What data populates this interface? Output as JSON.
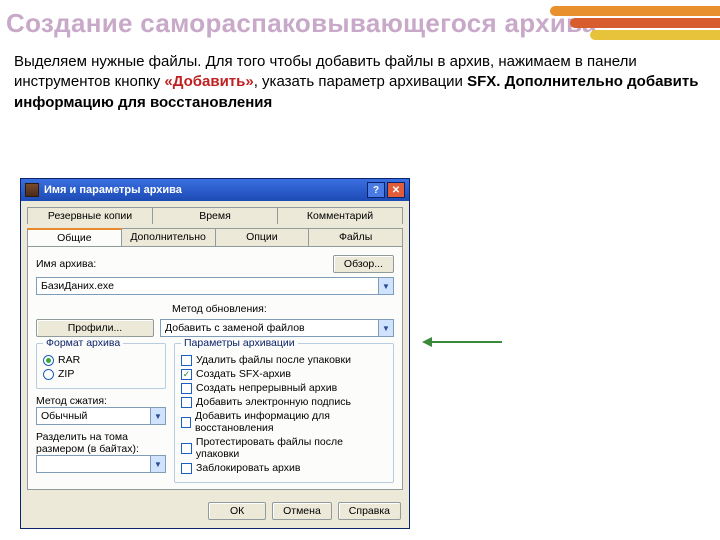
{
  "slide": {
    "title": "Создание самораспаковывающегося архива",
    "instruction_pre": "Выделяем нужные файлы. Для того чтобы добавить файлы в архив, нажимаем в панели инструментов кнопку ",
    "add_quoted": "«Добавить»",
    "instruction_mid": ",  указать параметр архивации ",
    "sfx_bold": "SFX. Дополнительно добавить информацию для восстановления"
  },
  "dialog": {
    "title": "Имя и параметры архива",
    "help_btn": "?",
    "close_btn": "✕",
    "tabs_top": [
      "Резервные копии",
      "Время",
      "Комментарий"
    ],
    "tabs_bottom": [
      "Общие",
      "Дополнительно",
      "Опции",
      "Файлы"
    ],
    "archive_name_label": "Имя архива:",
    "browse_btn": "Обзор...",
    "archive_name_value": "БазиДаних.exe",
    "profiles_btn": "Профили...",
    "update_label": "Метод обновления:",
    "update_value": "Добавить с заменой файлов",
    "format_group": "Формат архива",
    "format_options": [
      "RAR",
      "ZIP"
    ],
    "format_selected": "RAR",
    "compress_label": "Метод сжатия:",
    "compress_value": "Обычный",
    "split_label_a": "Разделить на тома",
    "split_label_b": "размером (в байтах):",
    "split_value": "",
    "params_group": "Параметры архивации",
    "params": [
      {
        "label": "Удалить файлы после упаковки",
        "checked": false
      },
      {
        "label": "Создать SFX-архив",
        "checked": true
      },
      {
        "label": "Создать непрерывный архив",
        "checked": false
      },
      {
        "label": "Добавить электронную подпись",
        "checked": false
      },
      {
        "label": "Добавить информацию для восстановления",
        "checked": false
      },
      {
        "label": "Протестировать файлы после упаковки",
        "checked": false
      },
      {
        "label": "Заблокировать архив",
        "checked": false
      }
    ],
    "buttons": [
      "ОК",
      "Отмена",
      "Справка"
    ]
  }
}
